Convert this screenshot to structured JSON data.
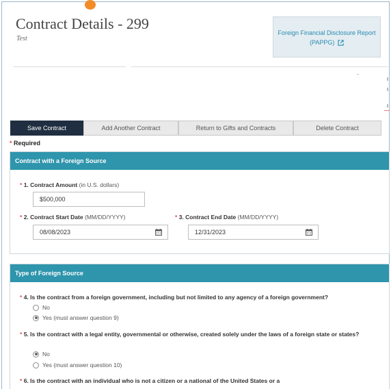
{
  "header": {
    "title": "Contract Details - 299",
    "subtitle": "Test",
    "report_link": "Foreign Financial Disclosure Report (PAPPG)"
  },
  "toolbar": {
    "save": "Save Contract",
    "add": "Add Another Contract",
    "return": "Return to Gifts and Contracts",
    "delete": "Delete Contract"
  },
  "required": {
    "star": "*",
    "text": "Required"
  },
  "contract_section": {
    "heading": "Contract with a Foreign Source",
    "amount": {
      "label": "1. Contract Amount",
      "hint": "(in U.S. dollars)",
      "value": "$500,000"
    },
    "start_date": {
      "label": "2. Contract Start Date",
      "hint": "(MM/DD/YYYY)",
      "value": "08/08/2023"
    },
    "end_date": {
      "label": "3. Contract End Date",
      "hint": "(MM/DD/YYYY)",
      "value": "12/31/2023"
    }
  },
  "source_section": {
    "heading": "Type of Foreign Source",
    "q4": {
      "text": "4. Is the contract from a foreign government, including but not limited to any agency of a foreign government?",
      "options": [
        "No",
        "Yes (must answer question 9)"
      ],
      "selected": "Yes (must answer question 9)"
    },
    "q5": {
      "text": "5. Is the contract with a legal entity, governmental or otherwise, created solely under the laws of a foreign state or states?",
      "options": [
        "No",
        "Yes (must answer question 10)"
      ],
      "selected": "No"
    },
    "q6": {
      "text": "6. Is the contract with an individual who is not a citizen or a national of the United States or a"
    }
  },
  "colors": {
    "panel_header": "#2e95ac",
    "primary_button": "#1f2e40",
    "link": "#2a8bb1",
    "required_star": "#d9534f"
  },
  "icons": [
    "external-link-icon",
    "calendar-icon",
    "radio-button"
  ]
}
